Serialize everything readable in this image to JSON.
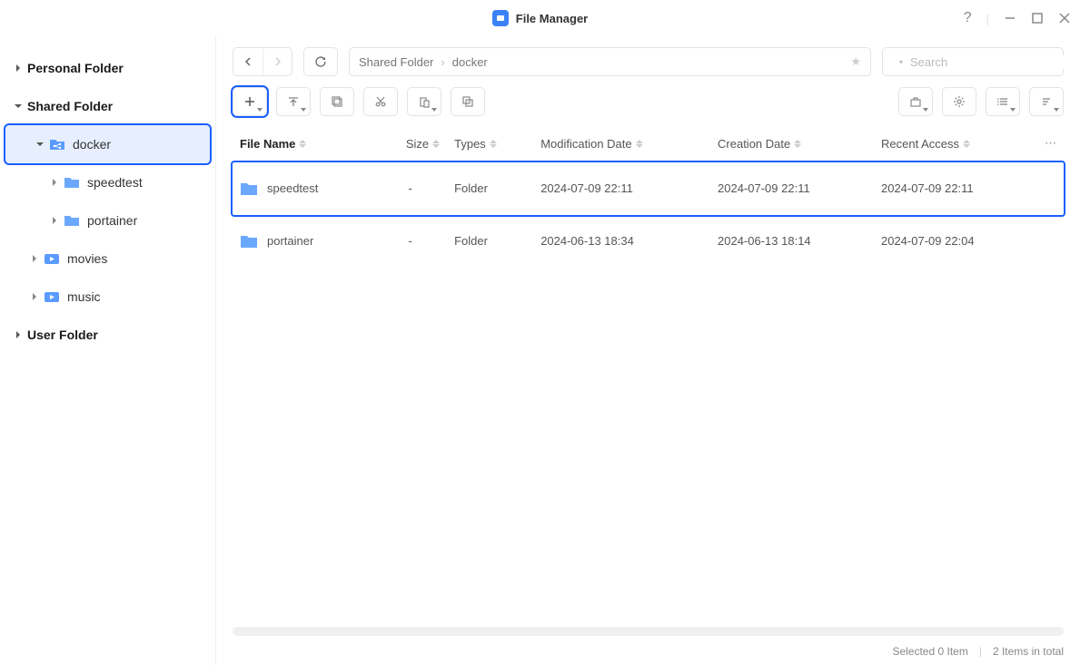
{
  "app": {
    "title": "File Manager"
  },
  "breadcrumb": {
    "root": "Shared Folder",
    "current": "docker"
  },
  "search": {
    "placeholder": "Search"
  },
  "sidebar": {
    "sections": [
      {
        "label": "Personal Folder",
        "expanded": false
      },
      {
        "label": "Shared Folder",
        "expanded": true,
        "children": [
          {
            "label": "docker",
            "selected": true,
            "expanded": true,
            "children": [
              {
                "label": "speedtest"
              },
              {
                "label": "portainer"
              }
            ]
          },
          {
            "label": "movies"
          },
          {
            "label": "music"
          }
        ]
      },
      {
        "label": "User Folder",
        "expanded": false
      }
    ]
  },
  "table": {
    "headers": {
      "name": "File Name",
      "size": "Size",
      "types": "Types",
      "modified": "Modification Date",
      "created": "Creation Date",
      "accessed": "Recent Access"
    },
    "rows": [
      {
        "name": "speedtest",
        "size": "-",
        "types": "Folder",
        "modified": "2024-07-09 22:11",
        "created": "2024-07-09 22:11",
        "accessed": "2024-07-09 22:11",
        "highlight": true
      },
      {
        "name": "portainer",
        "size": "-",
        "types": "Folder",
        "modified": "2024-06-13 18:34",
        "created": "2024-06-13 18:14",
        "accessed": "2024-07-09 22:04",
        "highlight": false
      }
    ]
  },
  "status": {
    "selected": "Selected 0 Item",
    "total": "2 Items in total"
  }
}
